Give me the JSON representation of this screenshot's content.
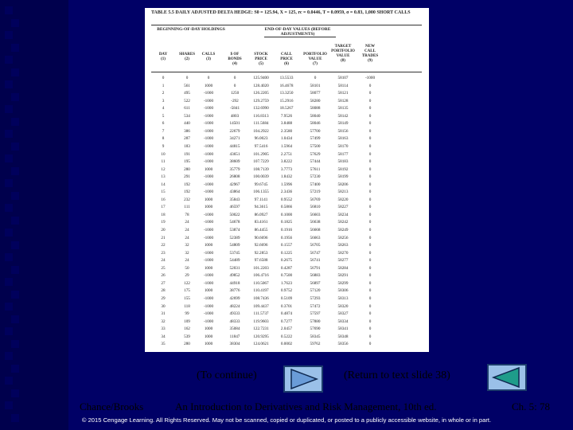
{
  "table": {
    "caption": "TABLE 5.5 DAILY ADJUSTED DELTA HEDGE: S0 = 125.94, X = 125, rc = 0.0446, T = 0.0959, σ = 0.83, 1,000 SHORT CALLS",
    "group_begin": "BEGINNING-OF-DAY HOLDINGS",
    "group_end": "END-OF-DAY VALUES (BEFORE ADJUSTMENTS)",
    "headers": [
      "DAY\n(1)",
      "SHARES\n(2)",
      "CALLS\n(3)",
      "$ OF\nBONDS\n(4)",
      "STOCK\nPRICE\n(5)",
      "CALL\nPRICE\n(6)",
      "PORTFOLIO\nVALUE\n(7)",
      "TARGET\nPORTFOLIO\nVALUE\n(8)",
      "NEW\nCALL\nTRADES\n(9)"
    ],
    "rows": [
      [
        "0",
        "0",
        "0",
        "0",
        "125.9400",
        "13.5533",
        "0",
        "58107",
        "-1000"
      ],
      [
        "1",
        "561",
        "1000",
        "0",
        "128.4020",
        "16.4678",
        "58101",
        "58114",
        "0"
      ],
      [
        "2",
        "495",
        "-1000",
        "1250",
        "126.2205",
        "13.3250",
        "58077",
        "58121",
        "0"
      ],
      [
        "3",
        "522",
        "-1000",
        "-292",
        "129.2759",
        "15.2916",
        "58280",
        "58128",
        "0"
      ],
      [
        "4",
        "611",
        "-1000",
        "-5841",
        "132.6990",
        "18.5267",
        "58088",
        "58135",
        "0"
      ],
      [
        "5",
        "534",
        "-1000",
        "4803",
        "116.8313",
        "7.9526",
        "58040",
        "58142",
        "0"
      ],
      [
        "6",
        "440",
        "-1000",
        "14501",
        "111.5684",
        "3.8488",
        "58046",
        "58149",
        "0"
      ],
      [
        "7",
        "386",
        "-1000",
        "22679",
        "104.2922",
        "2.3580",
        "57700",
        "58156",
        "0"
      ],
      [
        "8",
        "287",
        "-1000",
        "34271",
        "96.0023",
        "1.0434",
        "57499",
        "58163",
        "0"
      ],
      [
        "9",
        "183",
        "-1000",
        "44815",
        "97.5416",
        "1.5964",
        "57500",
        "58170",
        "0"
      ],
      [
        "10",
        "191",
        "-1000",
        "43651",
        "101.2905",
        "2.2751",
        "57629",
        "58177",
        "0"
      ],
      [
        "11",
        "195",
        "-1000",
        "38609",
        "107.7229",
        "3.8222",
        "57444",
        "58183",
        "0"
      ],
      [
        "12",
        "280",
        "1000",
        "35779",
        "108.7139",
        "3.7773",
        "57611",
        "58192",
        "0"
      ],
      [
        "13",
        "291",
        "-1000",
        "26808",
        "100.0039",
        "1.8432",
        "57230",
        "58199",
        "0"
      ],
      [
        "14",
        "192",
        "-1000",
        "42967",
        "99.6745",
        "1.5996",
        "57400",
        "58206",
        "0"
      ],
      [
        "15",
        "192",
        "-1000",
        "43864",
        "106.1355",
        "2.3436",
        "57219",
        "58213",
        "0"
      ],
      [
        "16",
        "232",
        "1000",
        "35843",
        "97.1141",
        "0.9552",
        "56769",
        "58220",
        "0"
      ],
      [
        "17",
        "111",
        "1000",
        "46597",
        "94.3615",
        "0.5866",
        "56810",
        "58227",
        "0"
      ],
      [
        "18",
        "78",
        "-1000",
        "50022",
        "86.0927",
        "0.1000",
        "56603",
        "58234",
        "0"
      ],
      [
        "19",
        "24",
        "-1000",
        "54678",
        "83.4161",
        "0.1825",
        "56638",
        "58242",
        "0"
      ],
      [
        "20",
        "24",
        "-1000",
        "53874",
        "86.4455",
        "0.1916",
        "56668",
        "58249",
        "0"
      ],
      [
        "21",
        "24",
        "-1000",
        "52389",
        "90.6696",
        "0.1956",
        "56663",
        "58256",
        "0"
      ],
      [
        "22",
        "32",
        "1000",
        "54809",
        "92.6696",
        "0.1557",
        "56705",
        "58263",
        "0"
      ],
      [
        "23",
        "32",
        "-1000",
        "53745",
        "92.2853",
        "0.1225",
        "56747",
        "58270",
        "0"
      ],
      [
        "24",
        "24",
        "-1000",
        "54489",
        "97.6588",
        "0.2675",
        "56741",
        "58277",
        "0"
      ],
      [
        "25",
        "50",
        "1000",
        "52031",
        "101.2203",
        "0.4287",
        "56791",
        "58284",
        "0"
      ],
      [
        "26",
        "29",
        "-1000",
        "49852",
        "106.4716",
        "0.7500",
        "56883",
        "58291",
        "0"
      ],
      [
        "27",
        "122",
        "-1000",
        "44918",
        "110.5067",
        "1.7623",
        "56897",
        "58299",
        "0"
      ],
      [
        "28",
        "175",
        "1000",
        "38776",
        "110.4197",
        "0.9752",
        "57120",
        "58306",
        "0"
      ],
      [
        "29",
        "155",
        "-1000",
        "42699",
        "108.7436",
        "0.5109",
        "57293",
        "58313",
        "0"
      ],
      [
        "30",
        "118",
        "-1000",
        "48224",
        "109.4437",
        "0.3701",
        "57472",
        "58320",
        "0"
      ],
      [
        "31",
        "99",
        "-1000",
        "49333",
        "111.5737",
        "0.4874",
        "57597",
        "58327",
        "0"
      ],
      [
        "32",
        "109",
        "-1000",
        "48333",
        "119.9603",
        "0.7277",
        "57880",
        "58334",
        "0"
      ],
      [
        "33",
        "162",
        "1000",
        "35084",
        "122.7231",
        "2.0457",
        "57690",
        "58341",
        "0"
      ],
      [
        "34",
        "539",
        "1000",
        "11847",
        "120.9295",
        "0.5222",
        "58345",
        "58348",
        "0"
      ],
      [
        "35",
        "280",
        "1000",
        "38304",
        "124.0621",
        "0.0002",
        "59762",
        "58356",
        "0"
      ]
    ]
  },
  "nav": {
    "continue_label": "(To continue)",
    "return_label": "(Return to text slide 38)",
    "next_arrow_color": "#6a9cd8",
    "back_arrow_color": "#1e9c8a"
  },
  "footer": {
    "author": "Chance/Brooks",
    "book": "An Introduction to Derivatives and Risk Management, 10th ed.",
    "slide": "Ch. 5: 78",
    "copyright": "© 2015 Cengage Learning. All Rights Reserved. May not be scanned, copied or duplicated, or posted to a publicly accessible website, in whole or in part."
  },
  "colors": {
    "background": "#000066",
    "table_bg": "#ffffff",
    "button_fill": "#9ac0e8",
    "copyright_text": "#ffffff"
  }
}
